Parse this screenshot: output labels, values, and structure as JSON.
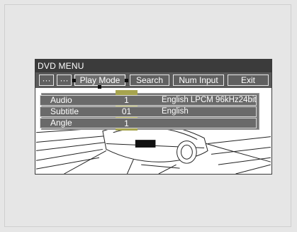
{
  "screen": {
    "title": "DVD MENU",
    "menu": [
      {
        "label": "···"
      },
      {
        "label": "···"
      },
      {
        "label": "Play Mode"
      },
      {
        "label": "Search"
      },
      {
        "label": "Num Input"
      },
      {
        "label": "Exit"
      }
    ],
    "rows": [
      {
        "label": "Audio",
        "number": "1",
        "value": "English  LPCM  96kHz24bit"
      },
      {
        "label": "Subtitle",
        "number": "01",
        "value": "English"
      },
      {
        "label": "Angle",
        "number": "1",
        "value": ""
      }
    ]
  },
  "colors": {
    "page_bg": "#e6e6e6",
    "titlebar": "#3b3b3b",
    "menubar": "#5a5a5a",
    "row_bg": "#6a6a6a",
    "highlight": "#a6a44e"
  }
}
